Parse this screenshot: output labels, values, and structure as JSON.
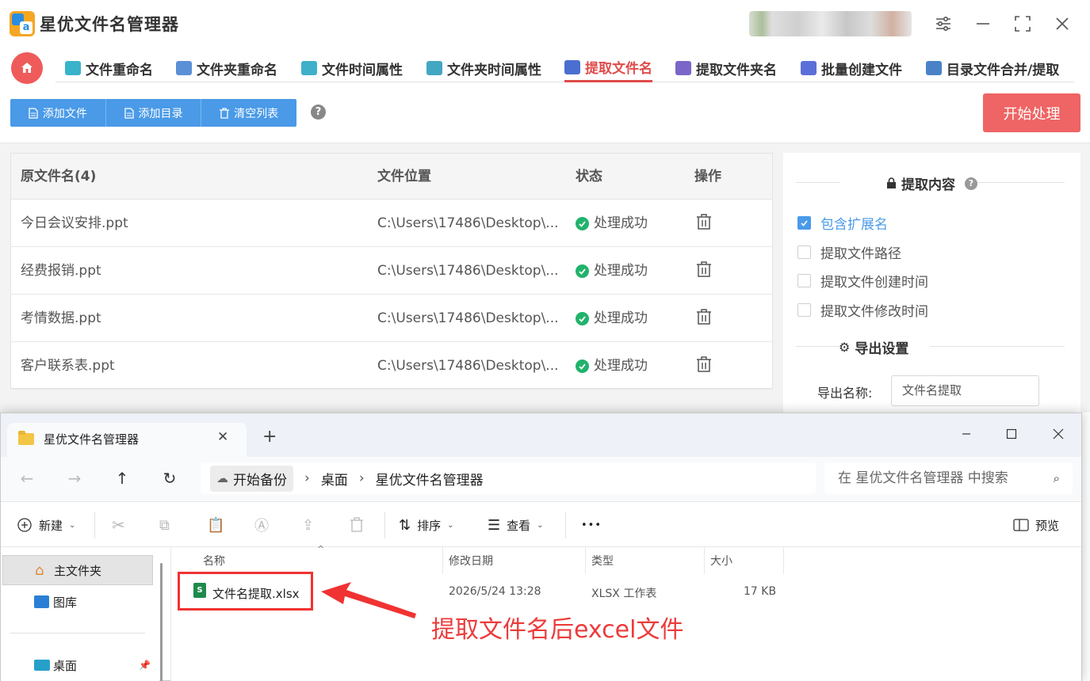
{
  "app": {
    "title": "星优文件名管理器",
    "logo_letter": "a",
    "colors": {
      "accent_red": "#e04b4b",
      "accent_blue": "#4a9ae8",
      "success": "#21b36b"
    }
  },
  "tabs": [
    {
      "label": "文件重命名",
      "icon": "rename-icon",
      "color": "#39b3c9"
    },
    {
      "label": "文件夹重命名",
      "icon": "folder-rename-icon",
      "color": "#5b8fd6"
    },
    {
      "label": "文件时间属性",
      "icon": "file-time-icon",
      "color": "#3fb0c9"
    },
    {
      "label": "文件夹时间属性",
      "icon": "folder-time-icon",
      "color": "#43a7c2"
    },
    {
      "label": "提取文件名",
      "icon": "extract-name-icon",
      "color": "#4b6fd0",
      "active": true
    },
    {
      "label": "提取文件夹名",
      "icon": "extract-folder-icon",
      "color": "#7a66c8"
    },
    {
      "label": "批量创建文件",
      "icon": "batch-create-icon",
      "color": "#5a6fd8"
    },
    {
      "label": "目录文件合并/提取",
      "icon": "merge-icon",
      "color": "#4a82c8"
    }
  ],
  "toolbar": {
    "add_file": "添加文件",
    "add_dir": "添加目录",
    "clear_list": "清空列表",
    "help": "?",
    "start": "开始处理"
  },
  "table": {
    "headers": {
      "name": "原文件名(4)",
      "location": "文件位置",
      "status": "状态",
      "action": "操作"
    },
    "rows": [
      {
        "name": "今日会议安排.ppt",
        "location": "C:\\Users\\17486\\Desktop\\...",
        "status": "处理成功"
      },
      {
        "name": "经费报销.ppt",
        "location": "C:\\Users\\17486\\Desktop\\...",
        "status": "处理成功"
      },
      {
        "name": "考情数据.ppt",
        "location": "C:\\Users\\17486\\Desktop\\...",
        "status": "处理成功"
      },
      {
        "name": "客户联系表.ppt",
        "location": "C:\\Users\\17486\\Desktop\\...",
        "status": "处理成功"
      }
    ]
  },
  "right_panel": {
    "extract_title": "提取内容",
    "options": [
      {
        "label": "包含扩展名",
        "checked": true
      },
      {
        "label": "提取文件路径",
        "checked": false
      },
      {
        "label": "提取文件创建时间",
        "checked": false
      },
      {
        "label": "提取文件修改时间",
        "checked": false
      }
    ],
    "export_title": "导出设置",
    "export_name_label": "导出名称:",
    "export_name_value": "文件名提取"
  },
  "explorer": {
    "tab_title": "星优文件名管理器",
    "breadcrumbs": [
      "开始备份",
      "桌面",
      "星优文件名管理器"
    ],
    "search_placeholder": "在 星优文件名管理器 中搜索",
    "commands": {
      "new": "新建",
      "sort": "排序",
      "view": "查看",
      "more": "•••",
      "preview": "预览"
    },
    "sidebar": [
      {
        "label": "主文件夹",
        "selected": true
      },
      {
        "label": "图库",
        "selected": false
      },
      {
        "label": "桌面",
        "selected": false
      }
    ],
    "columns": {
      "name": "名称",
      "modified": "修改日期",
      "type": "类型",
      "size": "大小"
    },
    "files": [
      {
        "name": "文件名提取.xlsx",
        "modified": "2026/5/24 13:28",
        "type": "XLSX 工作表",
        "size": "17 KB"
      }
    ]
  },
  "annotation": {
    "text": "提取文件名后excel文件"
  }
}
